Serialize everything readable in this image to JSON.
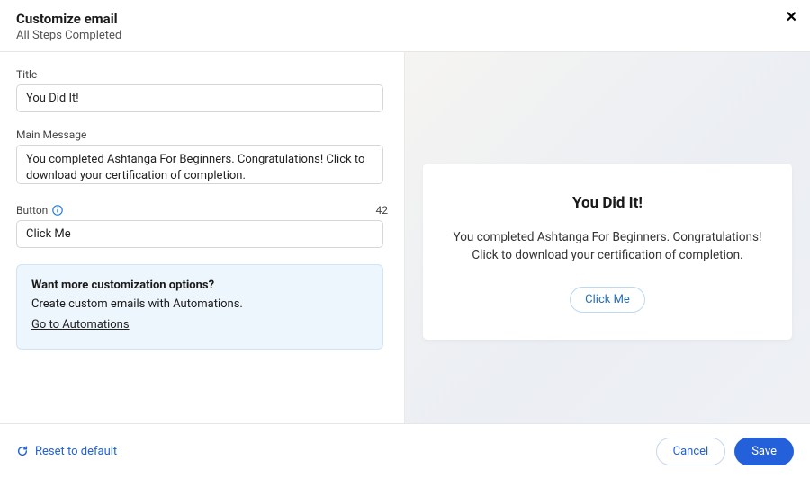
{
  "header": {
    "title": "Customize email",
    "subtitle": "All Steps Completed"
  },
  "form": {
    "title_label": "Title",
    "title_value": "You Did It!",
    "main_message_label": "Main Message",
    "main_message_value": "You completed Ashtanga For Beginners. Congratulations! Click to download your certification of completion.",
    "button_label": "Button",
    "button_char_count": "42",
    "button_value": "Click Me"
  },
  "callout": {
    "heading": "Want more customization options?",
    "body": "Create custom emails with Automations.",
    "link": "Go to Automations"
  },
  "preview": {
    "title": "You Did It!",
    "body": "You completed Ashtanga For Beginners. Congratulations! Click to download your certification of completion.",
    "button": "Click Me"
  },
  "footer": {
    "reset": "Reset to default",
    "cancel": "Cancel",
    "save": "Save"
  }
}
